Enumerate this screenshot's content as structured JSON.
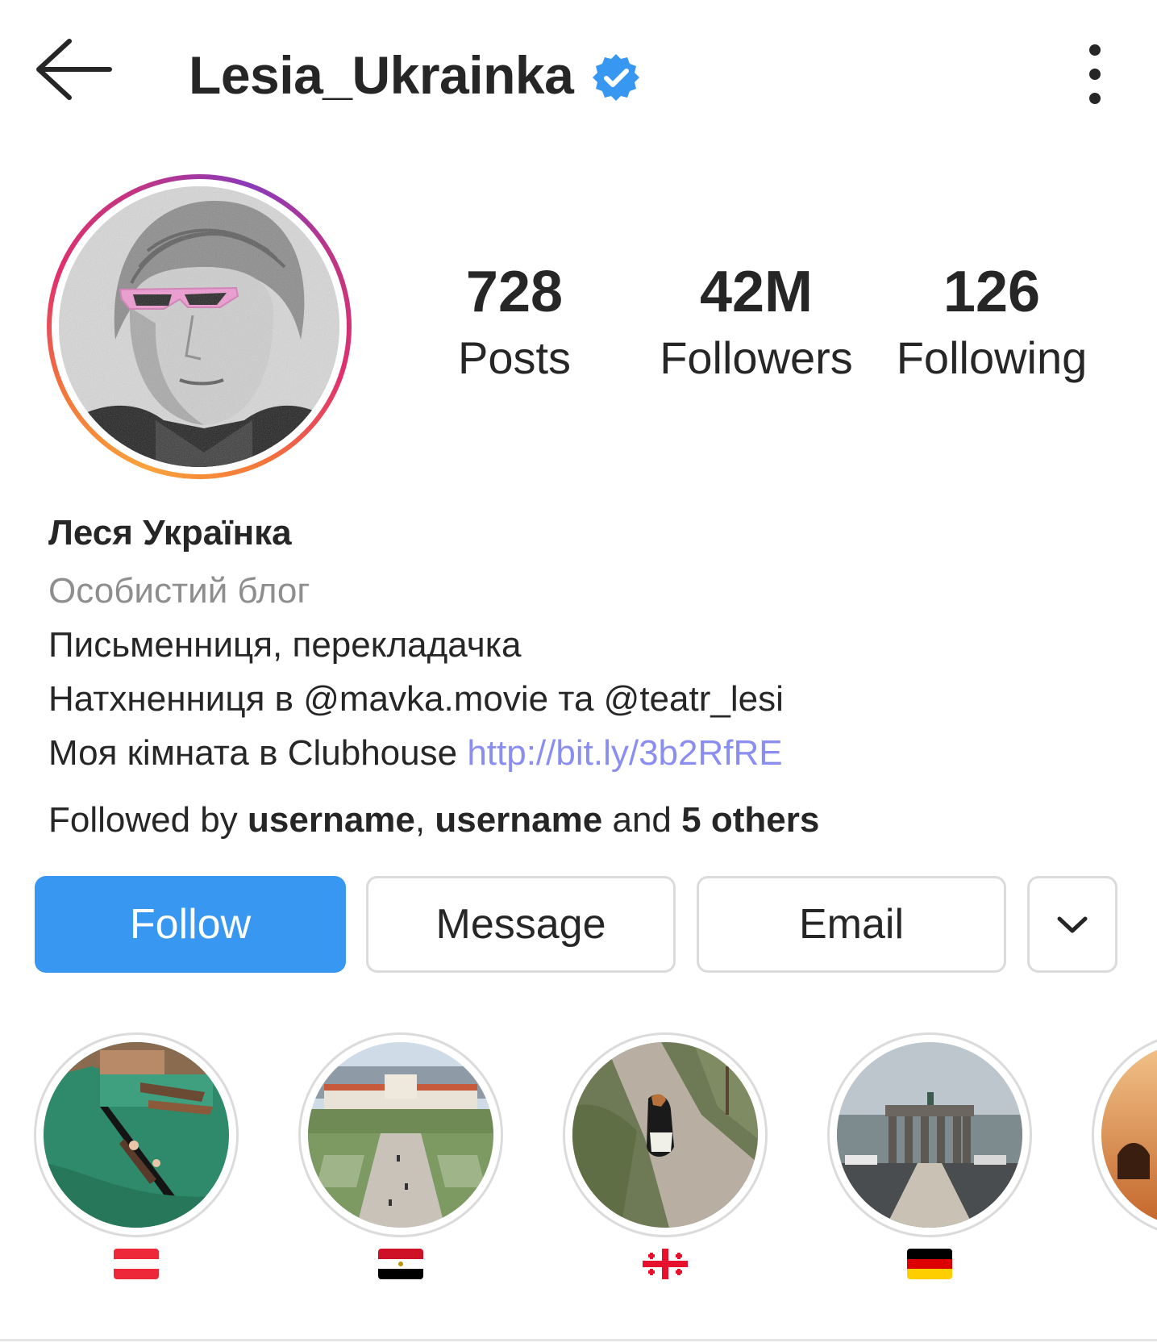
{
  "header": {
    "username": "Lesia_Ukrainka",
    "verified": true,
    "back_icon": "arrow-left-icon",
    "more_icon": "vertical-dots-icon"
  },
  "stats": {
    "posts_count": "728",
    "posts_label": "Posts",
    "followers_count": "42M",
    "followers_label": "Followers",
    "following_count": "126",
    "following_label": "Following"
  },
  "bio": {
    "name": "Леся Українка",
    "category": "Особистий блог",
    "line1": "Письменниця, перекладачка",
    "line2": "Натхненниця в @mavka.movie та @teatr_lesi",
    "line3_text": "Моя кімната в Clubhouse ",
    "line3_link": "http://bit.ly/3b2RfRE"
  },
  "followed_by": {
    "prefix": "Followed by ",
    "user1": "username",
    "separator": ", ",
    "user2": "username",
    "conjunction": " and ",
    "others": "5 others"
  },
  "actions": {
    "follow_label": "Follow",
    "message_label": "Message",
    "email_label": "Email",
    "more_icon": "chevron-down-icon"
  },
  "highlights": [
    {
      "label": "🇦🇹",
      "flag": "austria",
      "scene": "venice-canal-gondola"
    },
    {
      "label": "🇪🇬",
      "flag": "egypt",
      "scene": "palace-garden-aerial"
    },
    {
      "label": "🇬🇪",
      "flag": "georgia",
      "scene": "stone-path-dog"
    },
    {
      "label": "🇩🇪",
      "flag": "germany",
      "scene": "brandenburg-gate"
    },
    {
      "label": "",
      "flag": "partial",
      "scene": "desert-camels-sunset"
    }
  ],
  "colors": {
    "accent": "#3897f0",
    "link": "#8a8ef0",
    "verified": "#3897f0",
    "muted": "#8e8e8e",
    "text": "#262626",
    "border": "#dbdbdb"
  }
}
